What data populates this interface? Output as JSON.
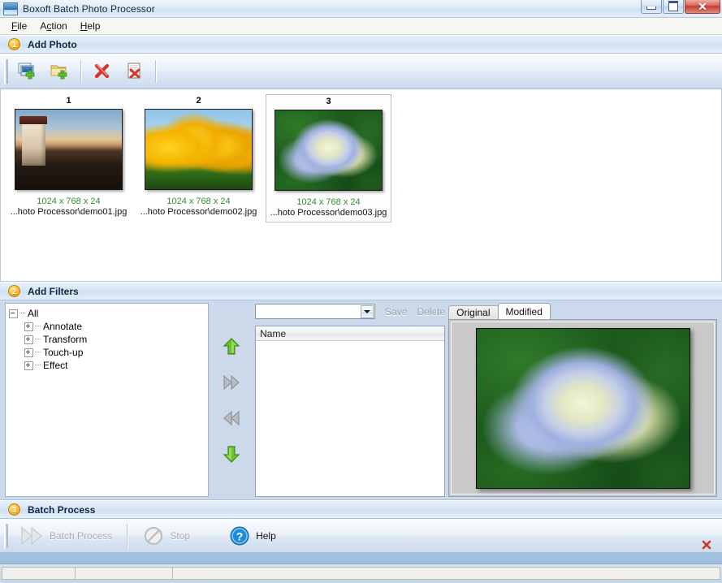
{
  "window": {
    "title": "Boxoft Batch Photo Processor",
    "minimize_label": "Minimize",
    "maximize_label": "Maximize",
    "close_label": "✕"
  },
  "menubar": {
    "items": [
      {
        "label": "File"
      },
      {
        "label": "Action"
      },
      {
        "label": "Help"
      }
    ]
  },
  "sections": {
    "add_photo": {
      "number": "1",
      "title": "Add Photo"
    },
    "add_filters": {
      "number": "2",
      "title": "Add Filters"
    },
    "batch_process": {
      "number": "3",
      "title": "Batch Process"
    }
  },
  "photo_toolbar": {
    "buttons": [
      {
        "name": "add-photo-icon",
        "tooltip": "Add Photo"
      },
      {
        "name": "add-folder-icon",
        "tooltip": "Add Folder"
      },
      {
        "name": "delete-icon",
        "tooltip": "Delete"
      },
      {
        "name": "delete-all-icon",
        "tooltip": "Delete All"
      }
    ]
  },
  "thumbnails": [
    {
      "number": "1",
      "meta": "1024 x 768 x 24",
      "path": "...hoto Processor\\demo01.jpg",
      "selected": false,
      "art": "photo-lighthouse"
    },
    {
      "number": "2",
      "meta": "1024 x 768 x 24",
      "path": "...hoto Processor\\demo02.jpg",
      "selected": false,
      "art": "photo-tulips"
    },
    {
      "number": "3",
      "meta": "1024 x 768 x 24",
      "path": "...hoto Processor\\demo03.jpg",
      "selected": true,
      "art": "photo-hydrangea"
    }
  ],
  "filter_tree": {
    "root": {
      "label": "All",
      "expanded": true
    },
    "children": [
      {
        "label": "Annotate",
        "expanded": false
      },
      {
        "label": "Transform",
        "expanded": false
      },
      {
        "label": "Touch-up",
        "expanded": false
      },
      {
        "label": "Effect",
        "expanded": false
      }
    ]
  },
  "preset": {
    "combo_value": "",
    "combo_placeholder": "",
    "save_label": "Save",
    "delete_label": "Delete",
    "save_enabled": false,
    "delete_enabled": false
  },
  "filter_list": {
    "columns": [
      "Name"
    ],
    "rows": []
  },
  "move_buttons": [
    {
      "name": "move-up-arrow-icon",
      "label": "Move Up",
      "enabled": true
    },
    {
      "name": "add-filter-arrow-icon",
      "label": "Add Filter",
      "enabled": false
    },
    {
      "name": "remove-filter-arrow-icon",
      "label": "Remove Filter",
      "enabled": false
    },
    {
      "name": "move-down-arrow-icon",
      "label": "Move Down",
      "enabled": true
    }
  ],
  "preview": {
    "tabs": [
      {
        "label": "Original",
        "active": false
      },
      {
        "label": "Modified",
        "active": true
      }
    ],
    "image_art": "photo-hydrangea"
  },
  "batch_toolbar": {
    "buttons": [
      {
        "label": "Batch Process",
        "icon": "batch-process-icon",
        "enabled": false
      },
      {
        "label": "Stop",
        "icon": "stop-icon",
        "enabled": false
      },
      {
        "label": "Help",
        "icon": "help-icon",
        "enabled": true
      }
    ]
  },
  "statusbar": {
    "cells": [
      "",
      "",
      ""
    ]
  },
  "colors": {
    "accent_blue": "#2d6ea8",
    "badge_orange": "#ffc233",
    "meta_green": "#2f8f2f",
    "close_red": "#c23f32",
    "section_header": "#d5e4f6"
  }
}
